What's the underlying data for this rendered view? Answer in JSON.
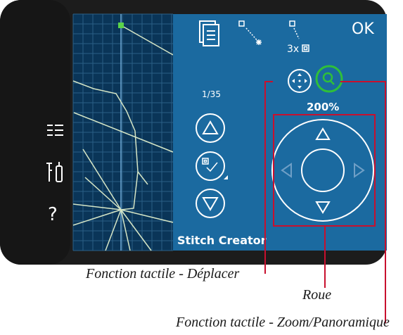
{
  "app": {
    "name": "Stitch Creator"
  },
  "side_toolbar": {
    "items": [
      {
        "icon": "list-icon"
      },
      {
        "icon": "tools-icon"
      },
      {
        "label": "?"
      }
    ]
  },
  "top_bar": {
    "ok_label": "OK",
    "stitch_multiplier": "3x",
    "icons": [
      "document-icon",
      "single-stitch-icon",
      "triple-stitch-icon"
    ]
  },
  "stitch_nav": {
    "counter": "1/35",
    "up_icon": "triangle-up-icon",
    "select_icon": "edit-select-icon",
    "down_icon": "triangle-down-icon"
  },
  "touch_modes": {
    "move_icon": "move-arrows-icon",
    "zoom_icon": "magnifier-icon",
    "active": "zoom-pan",
    "zoom_label": "200%"
  },
  "wheel": {
    "icons": [
      "arrow-up",
      "arrow-down",
      "arrow-left",
      "arrow-right",
      "center"
    ]
  },
  "captions": {
    "move": "Fonction tactile - Déplacer",
    "wheel": "Roue",
    "zoom": "Fonction tactile - Zoom/Panoramique"
  },
  "colors": {
    "frame": "#1c1c1c",
    "panel": "#1b6aa0",
    "grid_bg": "#0a3558",
    "zoom_active": "#2fbf3a",
    "annotation": "#c8102e"
  }
}
